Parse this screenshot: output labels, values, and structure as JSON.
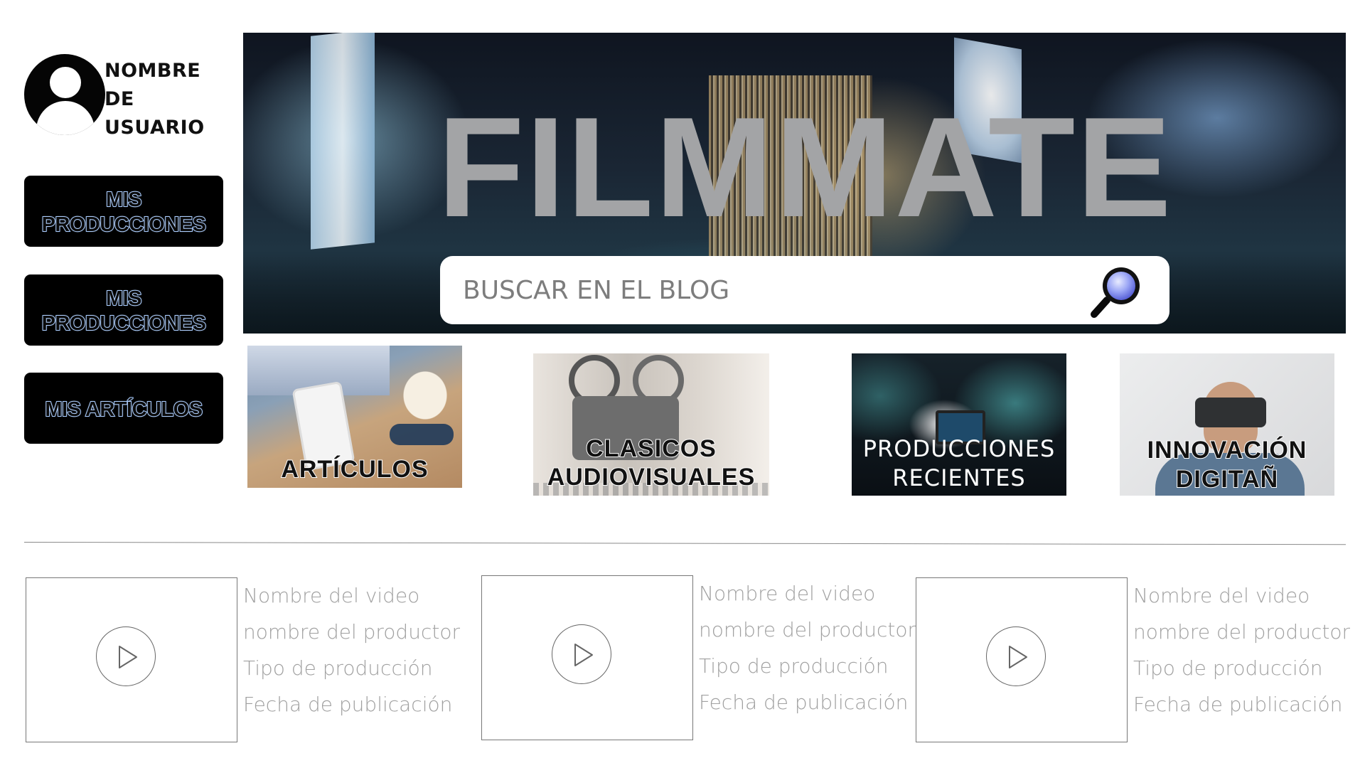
{
  "user": {
    "name": "NOMBRE DE USUARIO"
  },
  "sidebar": {
    "buttons": [
      {
        "label": "MIS PRODUCCIONES"
      },
      {
        "label": "MIS PRODUCCIONES"
      },
      {
        "label": "MIS ARTÍCULOS"
      }
    ]
  },
  "hero": {
    "title": "FILMMATE",
    "search_placeholder": "BUSCAR EN EL BLOG"
  },
  "categories": [
    {
      "label": "ARTÍCULOS"
    },
    {
      "label": "CLASICOS AUDIOVISUALES"
    },
    {
      "label": "PRODUCCIONES RECIENTES"
    },
    {
      "label": "INNOVACIÓN DIGITAÑ"
    }
  ],
  "videos": [
    {
      "name": "Nombre del video",
      "producer": "nombre del productor",
      "type": "Tipo de producción",
      "date": "Fecha de publicación"
    },
    {
      "name": "Nombre del video",
      "producer": "nombre del productor",
      "type": "Tipo de producción",
      "date": "Fecha de publicación"
    },
    {
      "name": "Nombre del video",
      "producer": "nombre del productor",
      "type": "Tipo de producción",
      "date": "Fecha de publicación"
    }
  ]
}
